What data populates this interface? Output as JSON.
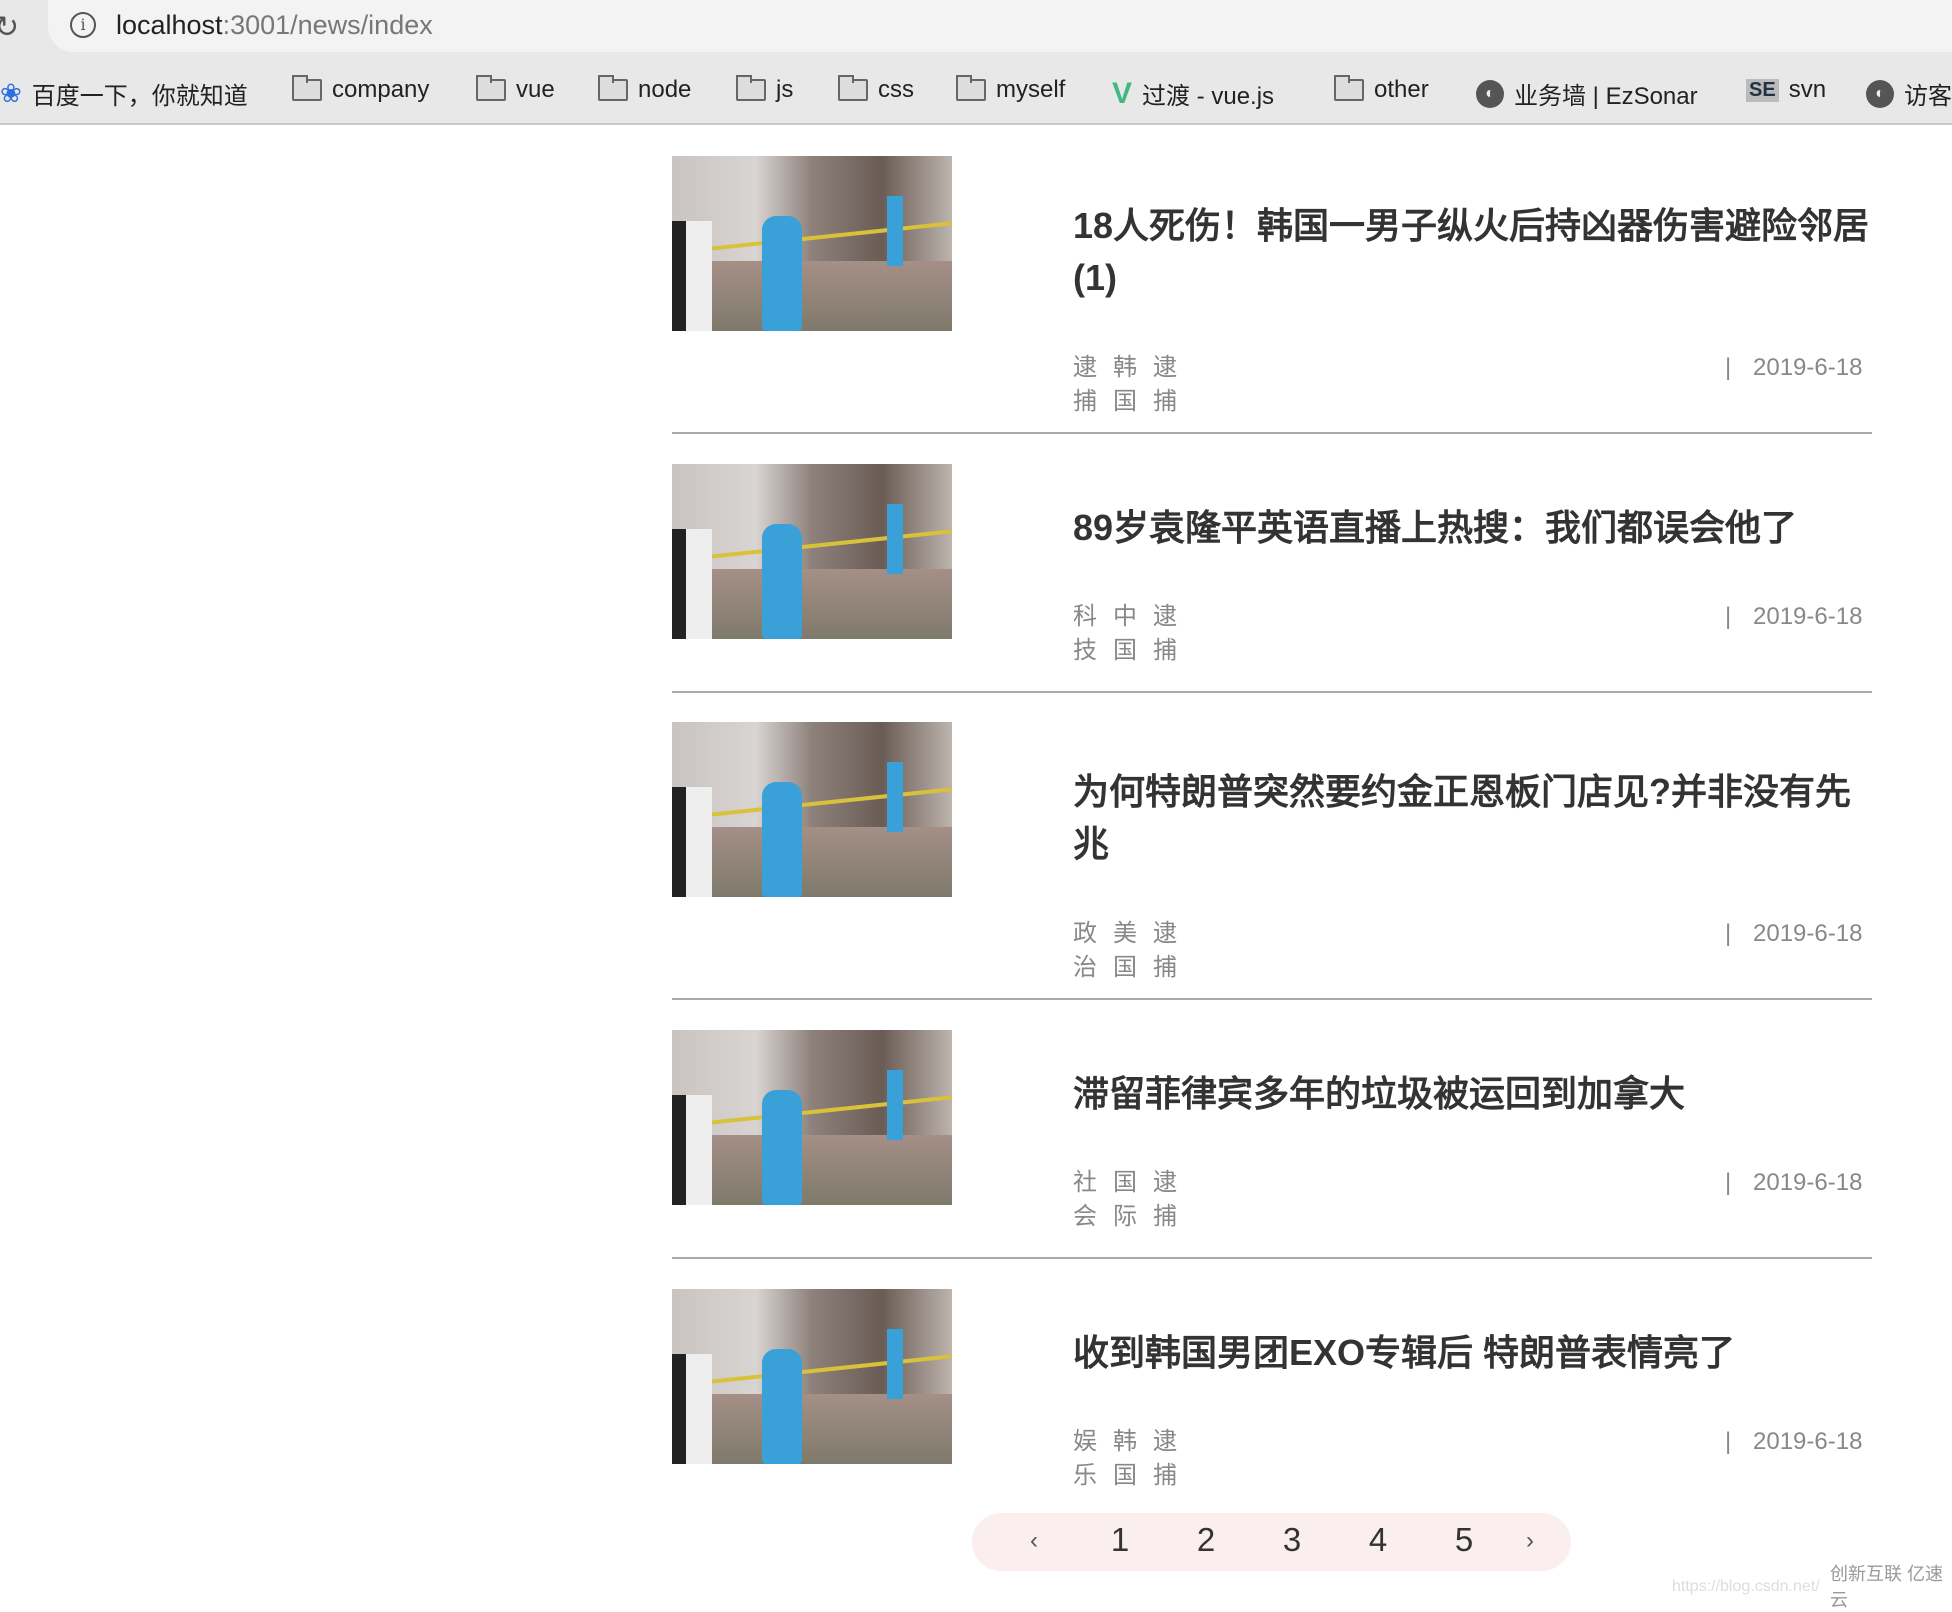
{
  "browser": {
    "url_host": "localhost",
    "url_path": ":3001/news/index"
  },
  "bookmarks": [
    {
      "label": "百度一下，你就知道",
      "icon": "baidu-paw-icon"
    },
    {
      "label": "company",
      "icon": "folder-icon"
    },
    {
      "label": "vue",
      "icon": "folder-icon"
    },
    {
      "label": "node",
      "icon": "folder-icon"
    },
    {
      "label": "js",
      "icon": "folder-icon"
    },
    {
      "label": "css",
      "icon": "folder-icon"
    },
    {
      "label": "myself",
      "icon": "folder-icon"
    },
    {
      "label": "过渡 - vue.js",
      "icon": "vue-logo-icon"
    },
    {
      "label": "other",
      "icon": "folder-icon"
    },
    {
      "label": "业务墙 | EzSonar",
      "icon": "globe-icon"
    },
    {
      "label": "svn",
      "icon": "se-icon"
    },
    {
      "label": "访客",
      "icon": "globe-icon"
    }
  ],
  "news": [
    {
      "title": "18人死伤！韩国一男子纵火后持凶器伤害避险邻居(1)",
      "tags": [
        "逮捕",
        "韩国",
        "逮捕"
      ],
      "separator": "|",
      "date": "2019-6-18"
    },
    {
      "title": "89岁袁隆平英语直播上热搜：我们都误会他了",
      "tags": [
        "科技",
        "中国",
        "逮捕"
      ],
      "separator": "|",
      "date": "2019-6-18"
    },
    {
      "title": "为何特朗普突然要约金正恩板门店见?并非没有先兆",
      "tags": [
        "政治",
        "美国",
        "逮捕"
      ],
      "separator": "|",
      "date": "2019-6-18"
    },
    {
      "title": "滞留菲律宾多年的垃圾被运回到加拿大",
      "tags": [
        "社会",
        "国际",
        "逮捕"
      ],
      "separator": "|",
      "date": "2019-6-18"
    },
    {
      "title": "收到韩国男团EXO专辑后 特朗普表情亮了",
      "tags": [
        "娱乐",
        "韩国",
        "逮捕"
      ],
      "separator": "|",
      "date": "2019-6-18"
    }
  ],
  "pagination": {
    "prev": "‹",
    "pages": [
      "1",
      "2",
      "3",
      "4",
      "5"
    ],
    "next": "›",
    "current": null,
    "bg_color": "#fbeeee"
  },
  "watermark": {
    "url": "https://blog.csdn.net/",
    "logo": "创新互联 亿速云"
  }
}
